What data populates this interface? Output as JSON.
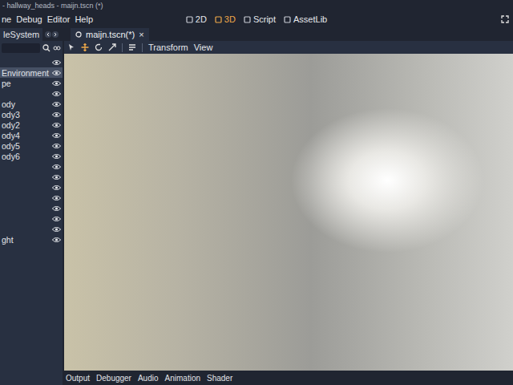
{
  "window": {
    "title": "- hallway_heads - maijn.tscn (*)"
  },
  "menu": [
    "ne",
    "Debug",
    "Editor",
    "Help"
  ],
  "workspaces": [
    {
      "label": "2D",
      "selected": false
    },
    {
      "label": "3D",
      "selected": true
    },
    {
      "label": "Script",
      "selected": false
    },
    {
      "label": "AssetLib",
      "selected": false
    }
  ],
  "dock": {
    "tab": "leSystem",
    "scene_tree": [
      {
        "label": "",
        "selected": false,
        "visible": true
      },
      {
        "label": "Environment",
        "selected": true,
        "visible": true
      },
      {
        "label": "pe",
        "selected": false,
        "visible": true
      },
      {
        "label": "",
        "selected": false,
        "visible": true
      },
      {
        "label": "ody",
        "selected": false,
        "visible": true
      },
      {
        "label": "ody3",
        "selected": false,
        "visible": true
      },
      {
        "label": "ody2",
        "selected": false,
        "visible": true
      },
      {
        "label": "ody4",
        "selected": false,
        "visible": true
      },
      {
        "label": "ody5",
        "selected": false,
        "visible": true
      },
      {
        "label": "ody6",
        "selected": false,
        "visible": true
      },
      {
        "label": "",
        "selected": false,
        "visible": true
      },
      {
        "label": "",
        "selected": false,
        "visible": true
      },
      {
        "label": "",
        "selected": false,
        "visible": true
      },
      {
        "label": "",
        "selected": false,
        "visible": true
      },
      {
        "label": "",
        "selected": false,
        "visible": true
      },
      {
        "label": "",
        "selected": false,
        "visible": true
      },
      {
        "label": "",
        "selected": false,
        "visible": true
      },
      {
        "label": "ght",
        "selected": false,
        "visible": true
      }
    ]
  },
  "scene_tabs": [
    {
      "label": "maijn.tscn(*)",
      "selected": true,
      "close": "×"
    }
  ],
  "toolbar": {
    "menus": [
      "Transform",
      "View"
    ]
  },
  "bottom_tabs": [
    "Output",
    "Debugger",
    "Audio",
    "Animation",
    "Shader"
  ]
}
